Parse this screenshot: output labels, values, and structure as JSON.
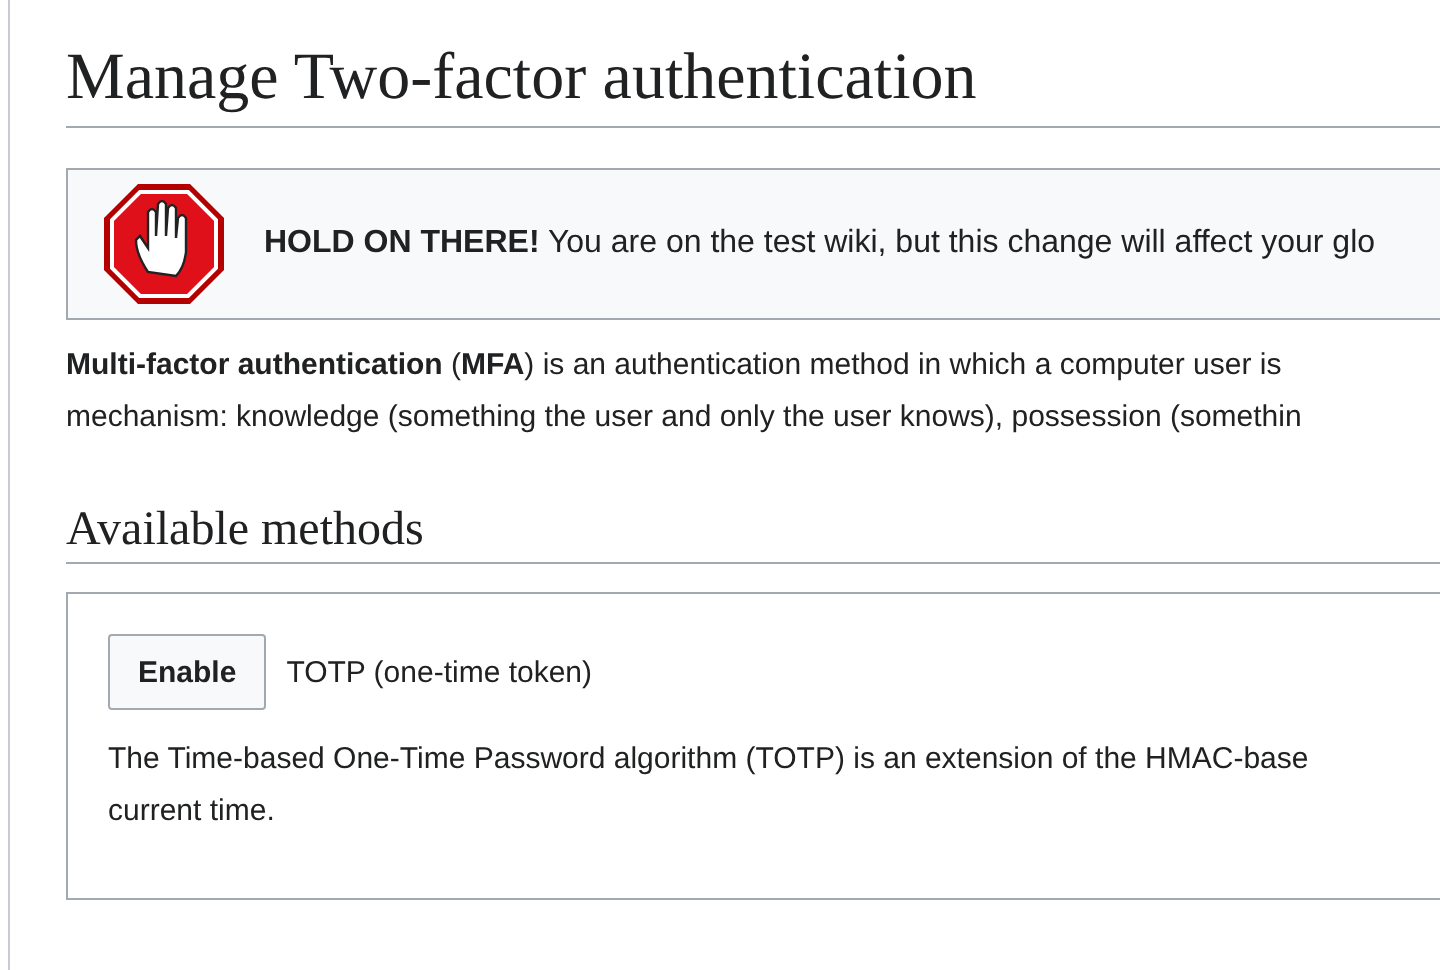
{
  "page_title": "Manage Two-factor authentication",
  "notice": {
    "text": "**HOLD ON THERE!** You are on the test wiki, but this change will affect your glo"
  },
  "intro_lines": [
    "**Multi-factor authentication** (**MFA**) is an authentication method in which a computer user is",
    "mechanism: knowledge (something the user and only the user knows), possession (somethin"
  ],
  "section_title": "Available methods",
  "methods": [
    {
      "button": "Enable",
      "name": "TOTP (one-time token)",
      "description_lines": [
        "The Time-based One-Time Password algorithm (TOTP) is an extension of the HMAC-base",
        "current time."
      ]
    }
  ]
}
